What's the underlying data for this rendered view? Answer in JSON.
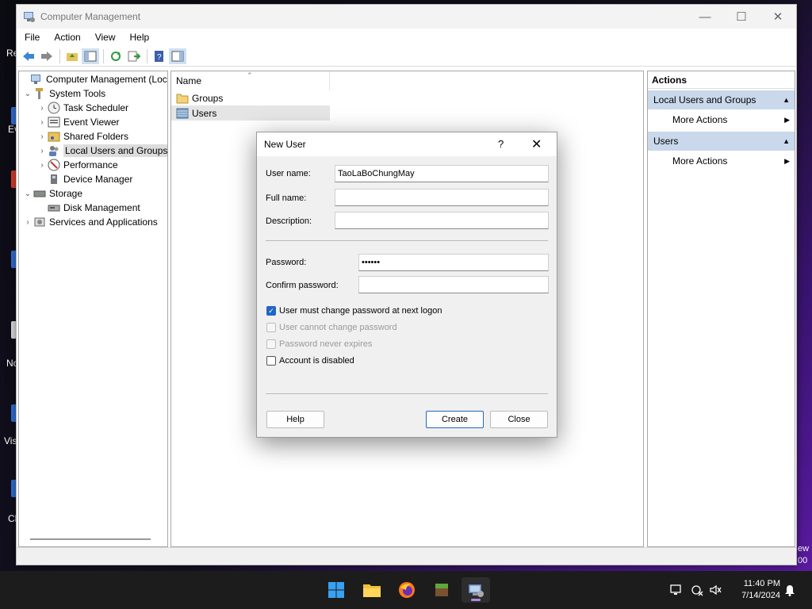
{
  "desktop": {
    "labels": [
      "Re",
      "Ev",
      "Nc",
      "Vis",
      "Ch",
      "ew",
      "00"
    ]
  },
  "window": {
    "title": "Computer Management",
    "menu": [
      "File",
      "Action",
      "View",
      "Help"
    ]
  },
  "tree": {
    "items": [
      {
        "label": "Computer Management (Local",
        "icon": "computer-management-icon"
      },
      {
        "label": "System Tools",
        "icon": "tools-icon"
      },
      {
        "label": "Task Scheduler",
        "icon": "clock-icon"
      },
      {
        "label": "Event Viewer",
        "icon": "event-viewer-icon"
      },
      {
        "label": "Shared Folders",
        "icon": "shared-folder-icon"
      },
      {
        "label": "Local Users and Groups",
        "icon": "users-icon"
      },
      {
        "label": "Performance",
        "icon": "performance-icon"
      },
      {
        "label": "Device Manager",
        "icon": "device-manager-icon"
      },
      {
        "label": "Storage",
        "icon": "storage-icon"
      },
      {
        "label": "Disk Management",
        "icon": "disk-icon"
      },
      {
        "label": "Services and Applications",
        "icon": "services-icon"
      }
    ]
  },
  "list": {
    "header": "Name",
    "items": [
      "Groups",
      "Users"
    ]
  },
  "actions": {
    "title": "Actions",
    "sections": [
      {
        "label": "Local Users and Groups",
        "item": "More Actions"
      },
      {
        "label": "Users",
        "item": "More Actions"
      }
    ]
  },
  "dialog": {
    "title": "New User",
    "help_glyph": "?",
    "fields": {
      "username_label": "User name:",
      "username_value": "TaoLaBoChungMay",
      "fullname_label": "Full name:",
      "fullname_value": "",
      "description_label": "Description:",
      "description_value": "",
      "password_label": "Password:",
      "password_value": "••••••",
      "confirm_label": "Confirm password:",
      "confirm_value": ""
    },
    "checkboxes": [
      {
        "label": "User must change password at next logon",
        "checked": true,
        "enabled": true
      },
      {
        "label": "User cannot change password",
        "checked": false,
        "enabled": false
      },
      {
        "label": "Password never expires",
        "checked": false,
        "enabled": false
      },
      {
        "label": "Account is disabled",
        "checked": false,
        "enabled": true
      }
    ],
    "buttons": {
      "help": "Help",
      "create": "Create",
      "close": "Close"
    }
  },
  "taskbar": {
    "time": "11:40 PM",
    "date": "7/14/2024"
  },
  "colors": {
    "accent": "#2166c4",
    "action_section": "#c9d8ea",
    "taskbar": "#1c1c1c"
  }
}
